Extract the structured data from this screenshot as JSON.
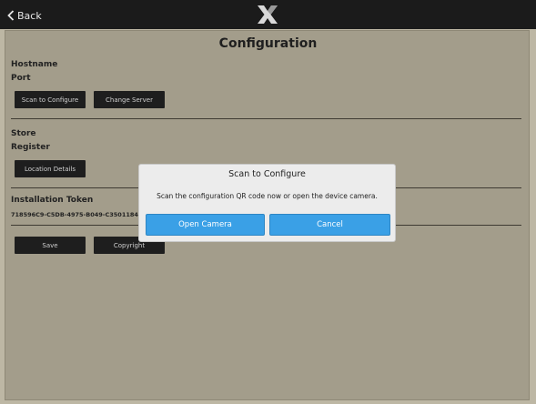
{
  "header": {
    "back_label": "Back",
    "logo_icon": "x-logo-icon"
  },
  "page": {
    "title": "Configuration"
  },
  "server_section": {
    "hostname_label": "Hostname",
    "port_label": "Port",
    "scan_button": "Scan to Configure",
    "change_server_button": "Change Server"
  },
  "store_section": {
    "store_label": "Store",
    "register_label": "Register",
    "location_button": "Location Details"
  },
  "token_section": {
    "label": "Installation Token",
    "value": "718596C9-C5DB-4975-B049-C3501184C"
  },
  "actions": {
    "save_button": "Save",
    "copyright_button": "Copyright"
  },
  "dialog": {
    "title": "Scan to Configure",
    "message": "Scan the configuration QR code now or open the device camera.",
    "open_camera_button": "Open Camera",
    "cancel_button": "Cancel"
  },
  "colors": {
    "accent": "#3aa0e6",
    "topbar": "#1b1b1b",
    "panel": "#a39d8b"
  }
}
